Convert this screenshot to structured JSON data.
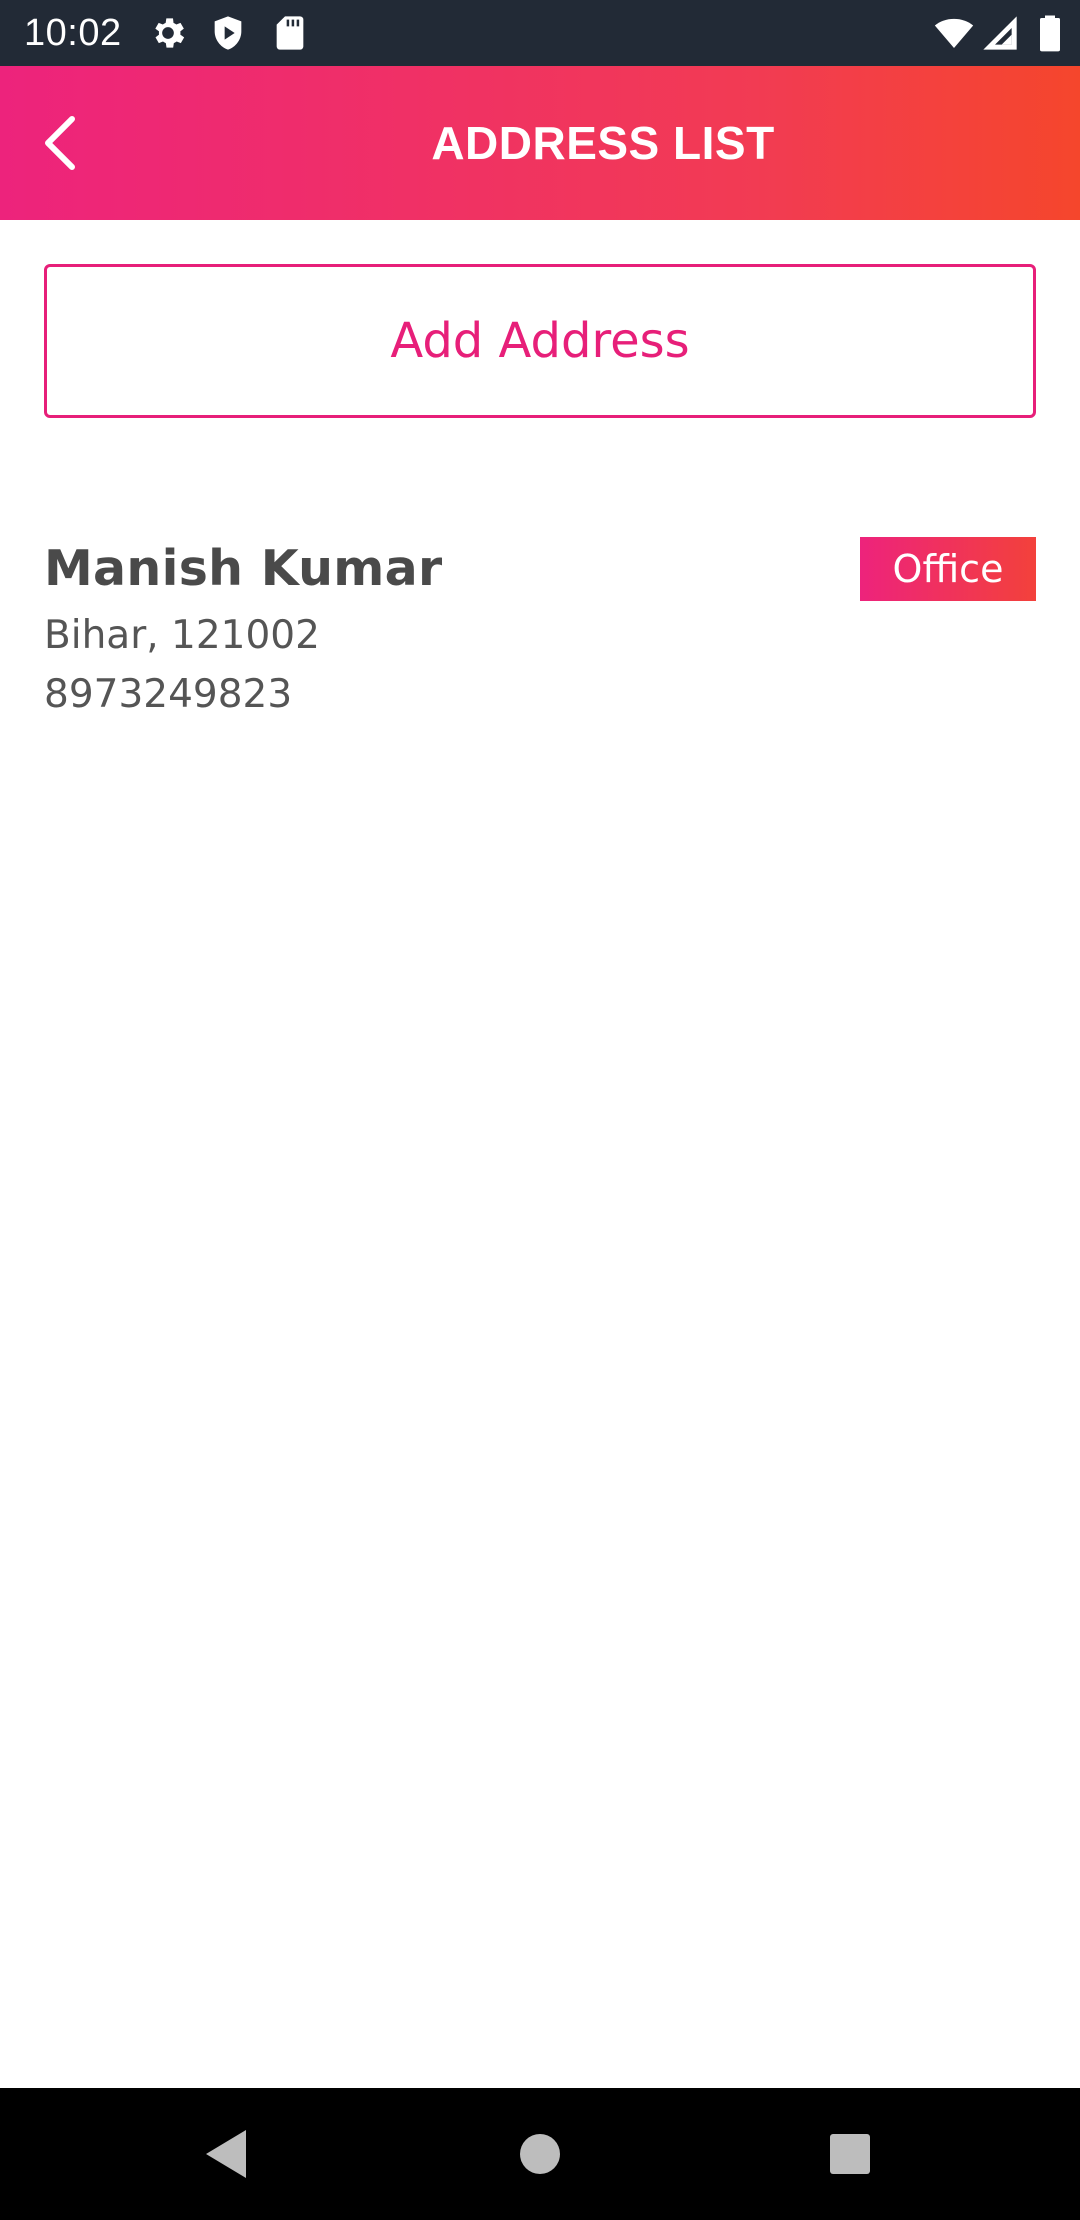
{
  "status_bar": {
    "time": "10:02",
    "icons": [
      "gear-icon",
      "shield-play-icon",
      "sd-card-icon",
      "wifi-icon",
      "signal-icon",
      "battery-icon"
    ]
  },
  "app_bar": {
    "title": "ADDRESS LIST",
    "back_icon": "chevron-left-icon",
    "gradient_start": "#ed237c",
    "gradient_end": "#f5462c"
  },
  "add_address": {
    "label": "Add Address",
    "accent_color": "#e71f79"
  },
  "addresses": [
    {
      "name": "Manish Kumar",
      "location": "Bihar, 121002",
      "phone": "8973249823",
      "type": "Office"
    }
  ],
  "nav_bar": {
    "buttons": [
      "back-triangle-icon",
      "home-circle-icon",
      "recents-square-icon"
    ]
  }
}
